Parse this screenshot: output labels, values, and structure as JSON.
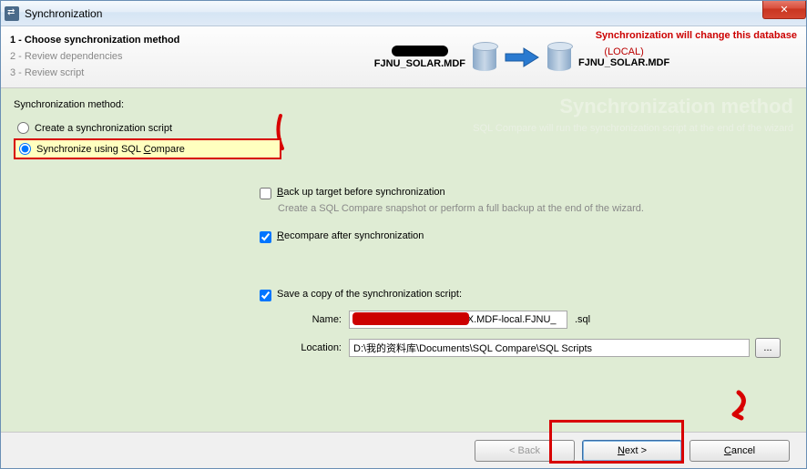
{
  "titlebar": {
    "title": "Synchronization"
  },
  "header": {
    "steps": [
      {
        "label": "1 - Choose synchronization method",
        "active": true
      },
      {
        "label": "2 - Review dependencies",
        "active": false
      },
      {
        "label": "3 - Review script",
        "active": false
      }
    ],
    "source_db": "FJNU_SOLAR.MDF",
    "target_sub": "(LOCAL)",
    "target_db": "FJNU_SOLAR.MDF",
    "warning": "Synchronization will change this database"
  },
  "content": {
    "section_title": "Synchronization method:",
    "watermark_title": "Synchronization method",
    "watermark_sub": "SQL Compare will run the synchronization script at the end of the wizard",
    "radios": {
      "create_script": "Create a synchronization script",
      "sync_compare_pre": "Synchronize using SQL ",
      "sync_compare_u": "C",
      "sync_compare_post": "ompare"
    },
    "checks": {
      "backup_u": "B",
      "backup_post": "ack up target before synchronization",
      "backup_desc": "Create a SQL Compare snapshot or perform a full backup at the end of the wizard.",
      "recompare_u": "R",
      "recompare_post": "ecompare after synchronization",
      "save_copy": "Save a copy of the synchronization script:"
    },
    "name_label": "Name:",
    "name_value": "XXXXXXXXXXXXXXXXXX.MDF-local.FJNU_",
    "name_ext": ".sql",
    "location_label": "Location:",
    "location_value": "D:\\我的资料库\\Documents\\SQL Compare\\SQL Scripts",
    "browse": "..."
  },
  "footer": {
    "back": "< Back",
    "next_u": "N",
    "next_post": "ext >",
    "cancel_u": "C",
    "cancel_post": "ancel"
  }
}
